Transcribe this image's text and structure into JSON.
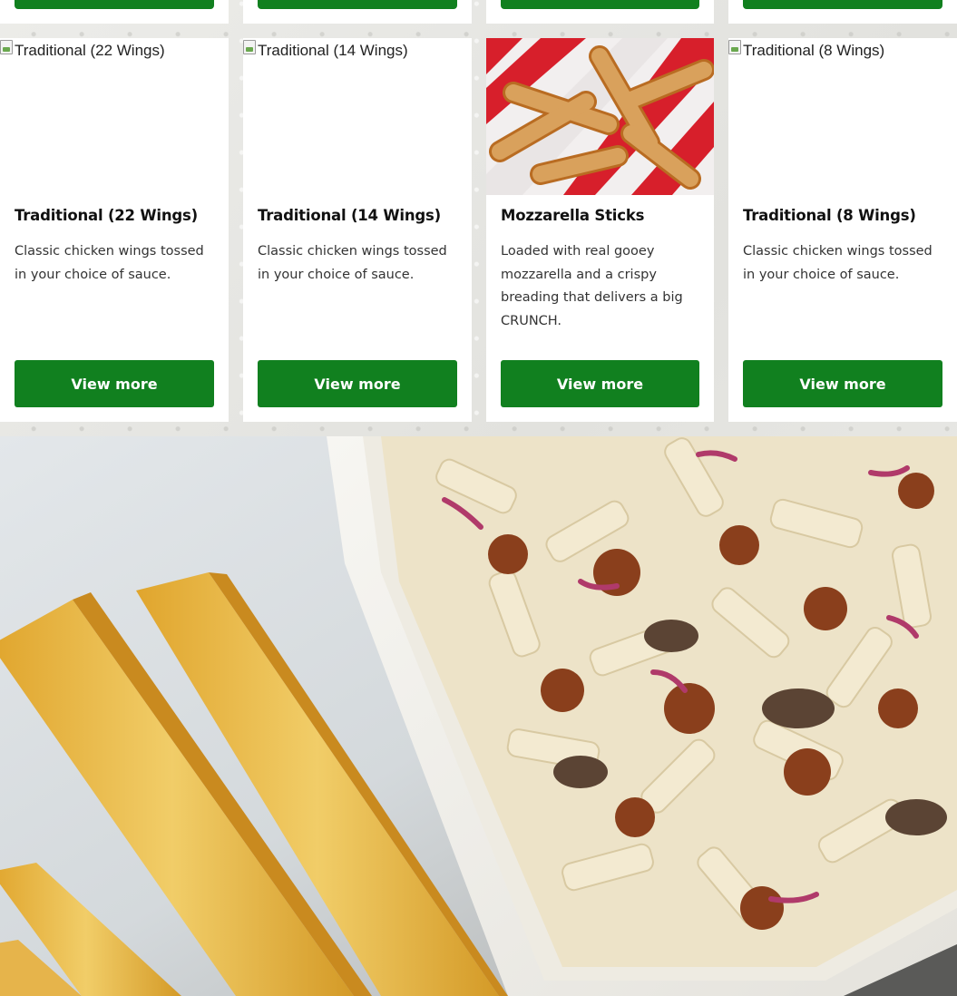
{
  "cards": [
    {
      "title": "Traditional (22 Wings)",
      "description": "Classic chicken wings tossed in your choice of sauce.",
      "image_alt": "Traditional (22 Wings)",
      "button": "View more"
    },
    {
      "title": "Traditional (14 Wings)",
      "description": "Classic chicken wings tossed in your choice of sauce.",
      "image_alt": "Traditional (14 Wings)",
      "button": "View more"
    },
    {
      "title": "Mozzarella Sticks",
      "description": "Loaded with real gooey mozzarella and a crispy breading that delivers a big CRUNCH.",
      "image_alt": "Mozzarella Sticks",
      "button": "View more"
    },
    {
      "title": "Traditional (8 Wings)",
      "description": "Classic chicken wings tossed in your choice of sauce.",
      "image_alt": "Traditional (8 Wings)",
      "button": "View more"
    }
  ],
  "colors": {
    "button_green": "#11801f",
    "card_background": "#ffffff",
    "title_text": "#111111",
    "body_text": "#333333"
  }
}
